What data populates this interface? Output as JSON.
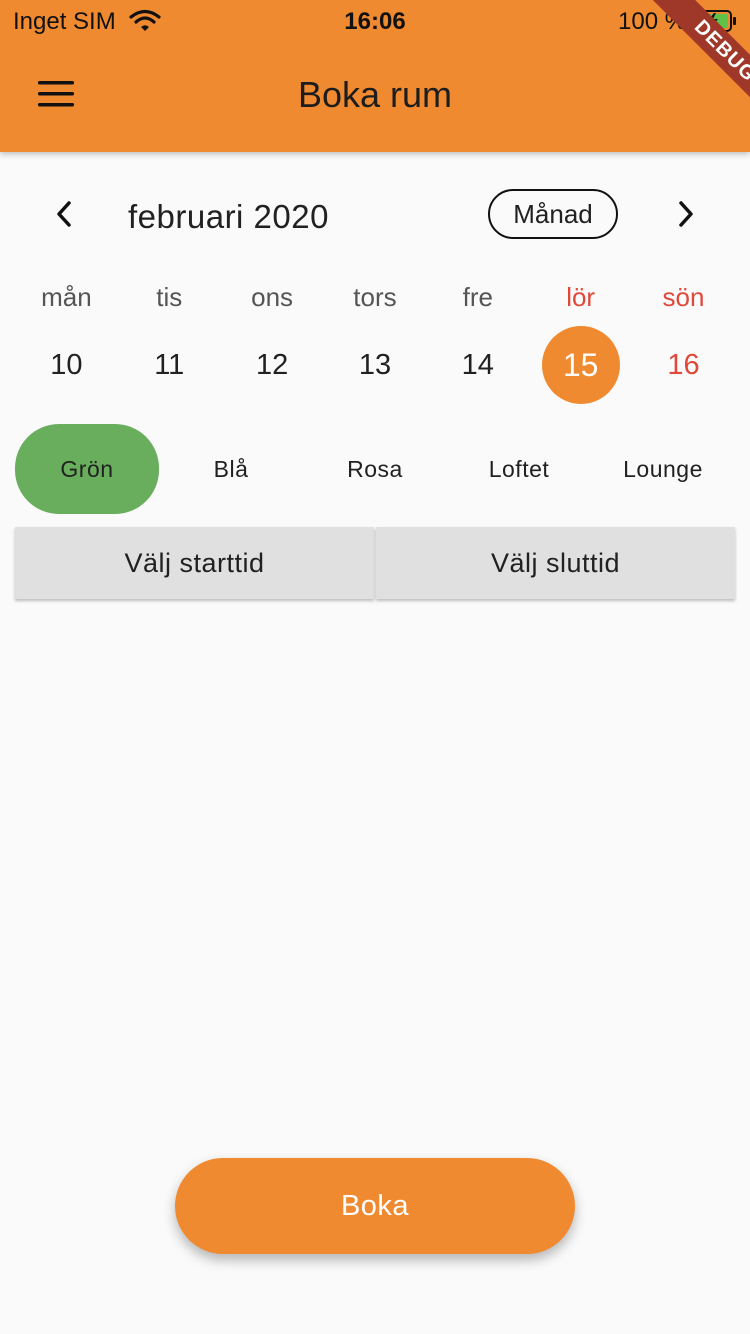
{
  "status_bar": {
    "carrier": "Inget SIM",
    "time": "16:06",
    "battery": "100 %"
  },
  "debug_banner": "DEBUG",
  "appbar": {
    "title": "Boka rum",
    "menu_icon": "hamburger-menu-icon"
  },
  "calendar": {
    "month_label": "februari 2020",
    "format_toggle": "Månad",
    "weekdays": [
      "mån",
      "tis",
      "ons",
      "tors",
      "fre",
      "lör",
      "sön"
    ],
    "days": [
      "10",
      "11",
      "12",
      "13",
      "14",
      "15",
      "16"
    ],
    "selected_day": "15",
    "weekend_color": "#e0483a"
  },
  "rooms": [
    "Grön",
    "Blå",
    "Rosa",
    "Loftet",
    "Lounge"
  ],
  "selected_room": "Grön",
  "time_buttons": {
    "start": "Välj starttid",
    "end": "Välj sluttid"
  },
  "book_button": "Boka",
  "colors": {
    "accent": "#f08a30",
    "room_selected": "#68ae5d",
    "time_button_bg": "#e0e0e0",
    "debug_ribbon": "#a0382a"
  }
}
